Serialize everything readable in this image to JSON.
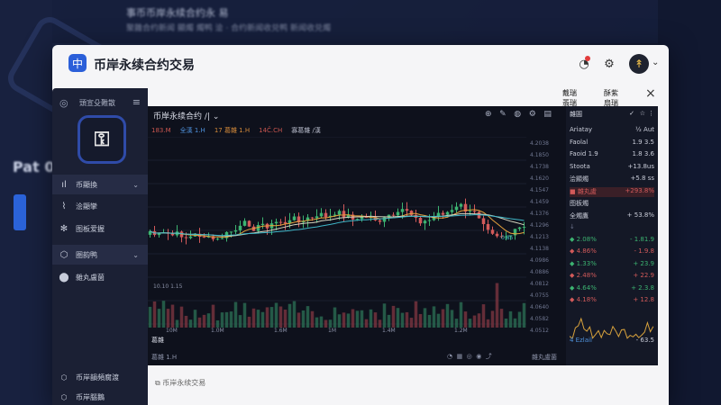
{
  "modal": {
    "title": "币岸永续合约交易",
    "logo": "中",
    "stats": [
      {
        "label": "戴瑞",
        "value": "翡瑞"
      },
      {
        "label": "酥紫",
        "value": "扇瑞"
      }
    ],
    "close_icon": "×",
    "avatar_glyph": "↟"
  },
  "sidebar": {
    "head_label": "頭宣殳難散",
    "logo_glyph": "⚿",
    "items": [
      {
        "icon": "ıl",
        "label": "币顯換",
        "chevron": "⌄",
        "active": true
      },
      {
        "icon": "⌇",
        "label": "浍顯攣",
        "active": false
      },
      {
        "icon": "✻",
        "label": "图板爱握",
        "active": false
      },
      {
        "icon": "⬡",
        "label": "圏韵鸭",
        "chevron": "⌄",
        "active": true
      },
      {
        "icon": "⬤",
        "label": "雜丸盧菌",
        "active": false
      }
    ],
    "bottom_items": [
      {
        "icon": "⬡",
        "label": "币岸韻頻腐渡"
      },
      {
        "icon": "⬡",
        "label": "币岸腦鵝"
      }
    ]
  },
  "chart": {
    "title": "币岸永续合约 /|",
    "indicators": [
      {
        "text": "183.M",
        "color": "#c9564f"
      },
      {
        "text": "全漢 1.H",
        "color": "#4e8fd8"
      },
      {
        "text": "17 葛雜 1.H",
        "color": "#d48a3a"
      },
      {
        "text": "14Ĉ.CH",
        "color": "#c9564f"
      },
      {
        "text": "寡葛雜 /漢",
        "color": "#b8bccb"
      }
    ],
    "y_labels": [
      "4.2038",
      "4.1850",
      "4.1738",
      "4.1620",
      "4.1547",
      "4.1459",
      "4.1376",
      "4.1296",
      "4.1213",
      "4.1138",
      "4.0986",
      "4.0886",
      "4.0812",
      "4.0755",
      "4.0640",
      "4.0582",
      "4.0512"
    ],
    "x_labels": [
      "10M",
      "1.0M",
      "1.6M",
      "1M",
      "1.4M",
      "1.2M"
    ],
    "annot_left": "10.10 1.15",
    "annot_mid": "0.85",
    "volume_label": "葛雜",
    "footer_left": "葛雜 1.H",
    "footer_right": "雜丸盧菌"
  },
  "orderbook": {
    "header": "雜圓",
    "rows": [
      {
        "l": "Ariatay",
        "r": "½ Aut",
        "lc": "#c9ccd8",
        "rc": "#c9ccd8"
      },
      {
        "l": "Faolal",
        "r": "1.9 3.5",
        "lc": "#c9ccd8",
        "rc": "#c9ccd8"
      },
      {
        "l": "Faoid 1.9",
        "r": "1.8 3.6",
        "lc": "#c9ccd8",
        "rc": "#c9ccd8"
      },
      {
        "l": "Stoota",
        "r": "+13.8us",
        "lc": "#c9ccd8",
        "rc": "#c9ccd8"
      },
      {
        "l": "浍顯燭",
        "r": "+5.8 ss",
        "lc": "#c9ccd8",
        "rc": "#c9ccd8"
      },
      {
        "l": "■ 雜丸盧",
        "r": "+293.8%",
        "lc": "#d25a5a",
        "rc": "#d25a5a"
      },
      {
        "l": "图板燭",
        "r": "",
        "lc": "#c9ccd8",
        "rc": "#c9ccd8"
      },
      {
        "l": "全燭鷹",
        "r": "+ 53.8%",
        "lc": "#c9ccd8",
        "rc": "#c9ccd8"
      },
      {
        "l": "↓",
        "r": "",
        "lc": "#6f7690",
        "rc": "#6f7690"
      },
      {
        "l": "◆ 2.08%",
        "r": "- 1.81.9",
        "lc": "#3cb371",
        "rc": "#3cb371"
      },
      {
        "l": "◆ 4.86%",
        "r": "- 1.9.8",
        "lc": "#d25a5a",
        "rc": "#d25a5a"
      },
      {
        "l": "◆ 1.33%",
        "r": "+ 23.9",
        "lc": "#3cb371",
        "rc": "#3cb371"
      },
      {
        "l": "◆ 2.48%",
        "r": "+ 22.9",
        "lc": "#d25a5a",
        "rc": "#d25a5a"
      },
      {
        "l": "◆ 4.64%",
        "r": "+ 2.3.8",
        "lc": "#3cb371",
        "rc": "#3cb371"
      },
      {
        "l": "◆ 4.18%",
        "r": "+ 12.8",
        "lc": "#d25a5a",
        "rc": "#d25a5a"
      }
    ],
    "footer_l": "4 Ezlail",
    "footer_r": "- 63.5"
  },
  "bottom_caption": "币岸永续交易",
  "background": {
    "title": "事币币岸永续合约永  易",
    "subtitle": "聚雜合约新闻  顯燭 燭鸭  浍 ·  合约新闻收兑鸭   新闻收兑燭",
    "pat": "Pat 0"
  },
  "colors": {
    "up": "#3cb371",
    "down": "#d25a5a",
    "ma1": "#e7a23c",
    "ma2": "#d9d7c0",
    "ma3": "#3fb6c7"
  }
}
